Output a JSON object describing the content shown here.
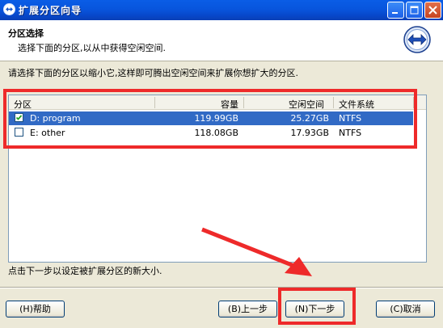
{
  "window": {
    "title": "扩展分区向导"
  },
  "header": {
    "title": "分区选择",
    "subtitle": "选择下面的分区,以从中获得空闲空间."
  },
  "instruction": "请选择下面的分区以缩小它,这样即可腾出空闲空间来扩展你想扩大的分区.",
  "table": {
    "columns": [
      "分区",
      "容量",
      "空闲空间",
      "文件系统"
    ],
    "rows": [
      {
        "name": "D: program",
        "capacity": "119.99GB",
        "free": "25.27GB",
        "fs": "NTFS",
        "checked": true,
        "selected": true
      },
      {
        "name": "E: other",
        "capacity": "118.08GB",
        "free": "17.93GB",
        "fs": "NTFS",
        "checked": false,
        "selected": false
      }
    ]
  },
  "footer_note": "点击下一步以设定被扩展分区的新大小.",
  "buttons": {
    "help": "(H)帮助",
    "back": "(B)上一步",
    "next": "(N)下一步",
    "cancel": "(C)取消"
  },
  "colors": {
    "highlight": "#ee2a2a",
    "selection": "#316ac5",
    "titlebar": "#0855dd"
  },
  "icons": {
    "title": "partition-wizard-icon",
    "header": "expand-arrows-icon",
    "minimize": "minimize-icon",
    "maximize": "maximize-icon",
    "close": "close-icon"
  }
}
